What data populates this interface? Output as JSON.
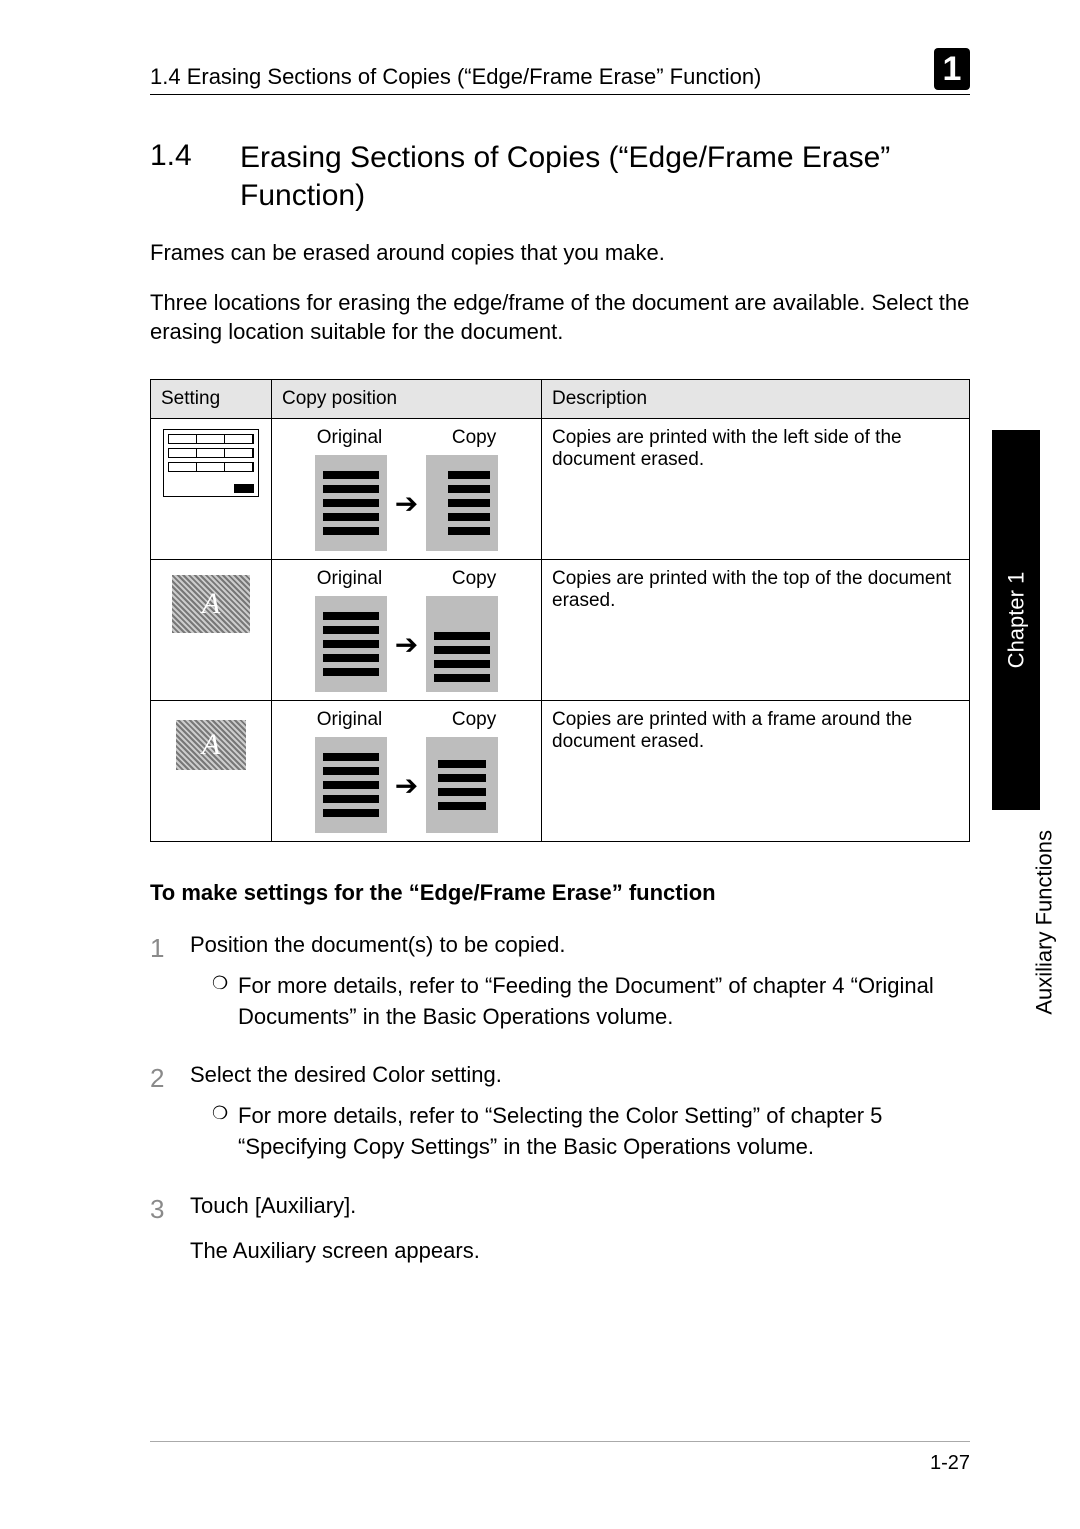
{
  "header": {
    "running_title": "1.4 Erasing Sections of Copies (“Edge/Frame Erase” Function)",
    "chapter_badge": "1"
  },
  "section": {
    "number": "1.4",
    "title": "Erasing Sections of Copies (“Edge/Frame Erase” Function)"
  },
  "paragraphs": {
    "p1": "Frames can be erased around copies that you make.",
    "p2": "Three locations for erasing the edge/frame of the document are available. Select the erasing location suitable for the document."
  },
  "table": {
    "headers": {
      "setting": "Setting",
      "copy_position": "Copy position",
      "description": "Description"
    },
    "labels": {
      "original": "Original",
      "copy": "Copy"
    },
    "rows": [
      {
        "description": "Copies are printed with the left side of the document erased."
      },
      {
        "description": "Copies are printed with the top of the document erased."
      },
      {
        "description": "Copies are printed with a frame around the document erased."
      }
    ]
  },
  "subhead": "To make settings for the “Edge/Frame Erase” function",
  "steps": [
    {
      "num": "1",
      "text": "Position the document(s) to be copied.",
      "note": "For more details, refer to “Feeding the Document” of chapter 4 “Original Documents” in the Basic Operations volume."
    },
    {
      "num": "2",
      "text": "Select the desired Color setting.",
      "note": "For more details, refer to “Selecting the Color Setting” of chapter 5 “Specifying Copy Settings” in the Basic Operations volume."
    },
    {
      "num": "3",
      "text": "Touch [Auxiliary].",
      "extra": "The Auxiliary screen appears."
    }
  ],
  "side": {
    "tab": "Chapter 1",
    "label": "Auxiliary Functions"
  },
  "footer": {
    "page": "1-27"
  },
  "icons": {
    "arrow": "➔",
    "bullet": "❍"
  }
}
